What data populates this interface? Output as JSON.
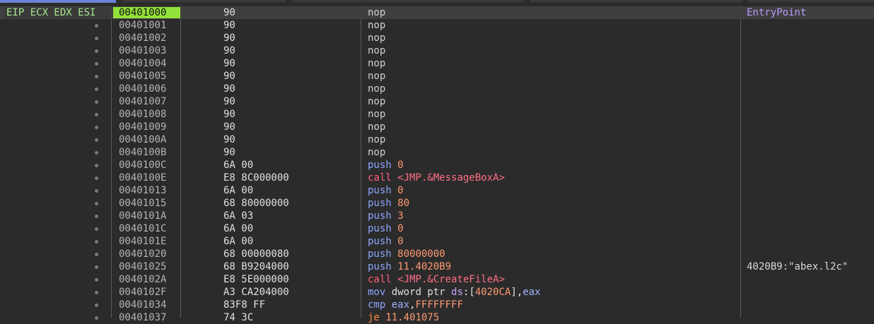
{
  "registers_label": "EIP ECX EDX ESI",
  "entry_comment": "EntryPoint",
  "rows": [
    {
      "addr": "00401000",
      "bytes": "90",
      "mnemonic": "nop",
      "ops": [],
      "comment": "EntryPoint",
      "current": true
    },
    {
      "addr": "00401001",
      "bytes": "90",
      "mnemonic": "nop",
      "ops": []
    },
    {
      "addr": "00401002",
      "bytes": "90",
      "mnemonic": "nop",
      "ops": []
    },
    {
      "addr": "00401003",
      "bytes": "90",
      "mnemonic": "nop",
      "ops": []
    },
    {
      "addr": "00401004",
      "bytes": "90",
      "mnemonic": "nop",
      "ops": []
    },
    {
      "addr": "00401005",
      "bytes": "90",
      "mnemonic": "nop",
      "ops": []
    },
    {
      "addr": "00401006",
      "bytes": "90",
      "mnemonic": "nop",
      "ops": []
    },
    {
      "addr": "00401007",
      "bytes": "90",
      "mnemonic": "nop",
      "ops": []
    },
    {
      "addr": "00401008",
      "bytes": "90",
      "mnemonic": "nop",
      "ops": []
    },
    {
      "addr": "00401009",
      "bytes": "90",
      "mnemonic": "nop",
      "ops": []
    },
    {
      "addr": "0040100A",
      "bytes": "90",
      "mnemonic": "nop",
      "ops": []
    },
    {
      "addr": "0040100B",
      "bytes": "90",
      "mnemonic": "nop",
      "ops": []
    },
    {
      "addr": "0040100C",
      "bytes": "6A 00",
      "mnemonic": "push",
      "ops": [
        {
          "t": "0",
          "c": "num"
        }
      ]
    },
    {
      "addr": "0040100E",
      "bytes": "E8 8C000000",
      "mnemonic": "call",
      "ops": [
        {
          "t": "<JMP.&MessageBoxA>",
          "c": "call"
        }
      ]
    },
    {
      "addr": "00401013",
      "bytes": "6A 00",
      "mnemonic": "push",
      "ops": [
        {
          "t": "0",
          "c": "num"
        }
      ]
    },
    {
      "addr": "00401015",
      "bytes": "68 80000000",
      "mnemonic": "push",
      "ops": [
        {
          "t": "80",
          "c": "num"
        }
      ]
    },
    {
      "addr": "0040101A",
      "bytes": "6A 03",
      "mnemonic": "push",
      "ops": [
        {
          "t": "3",
          "c": "num"
        }
      ]
    },
    {
      "addr": "0040101C",
      "bytes": "6A 00",
      "mnemonic": "push",
      "ops": [
        {
          "t": "0",
          "c": "num"
        }
      ]
    },
    {
      "addr": "0040101E",
      "bytes": "6A 00",
      "mnemonic": "push",
      "ops": [
        {
          "t": "0",
          "c": "num"
        }
      ]
    },
    {
      "addr": "00401020",
      "bytes": "68 00000080",
      "mnemonic": "push",
      "ops": [
        {
          "t": "80000000",
          "c": "num"
        }
      ]
    },
    {
      "addr": "00401025",
      "bytes": "68 B9204000",
      "mnemonic": "push",
      "ops": [
        {
          "t": "11.4020B9",
          "c": "num"
        }
      ],
      "comment": "4020B9:\"abex.l2c\""
    },
    {
      "addr": "0040102A",
      "bytes": "E8 5E000000",
      "mnemonic": "call",
      "ops": [
        {
          "t": "<JMP.&CreateFileA>",
          "c": "call"
        }
      ]
    },
    {
      "addr": "0040102F",
      "bytes": "A3 CA204000",
      "mnemonic": "mov",
      "ops": [
        {
          "t": "dword ptr ",
          "c": "text"
        },
        {
          "t": "ds",
          "c": "seg"
        },
        {
          "t": ":[",
          "c": "text"
        },
        {
          "t": "4020CA",
          "c": "num"
        },
        {
          "t": "],",
          "c": "text"
        },
        {
          "t": "eax",
          "c": "reg"
        }
      ]
    },
    {
      "addr": "00401034",
      "bytes": "83F8 FF",
      "mnemonic": "cmp",
      "ops": [
        {
          "t": "eax",
          "c": "reg"
        },
        {
          "t": ",",
          "c": "text"
        },
        {
          "t": "FFFFFFFF",
          "c": "num"
        }
      ]
    },
    {
      "addr": "00401037",
      "bytes": "74 3C",
      "mnemonic": "je",
      "ops": [
        {
          "t": "11.401075",
          "c": "num"
        }
      ]
    }
  ]
}
